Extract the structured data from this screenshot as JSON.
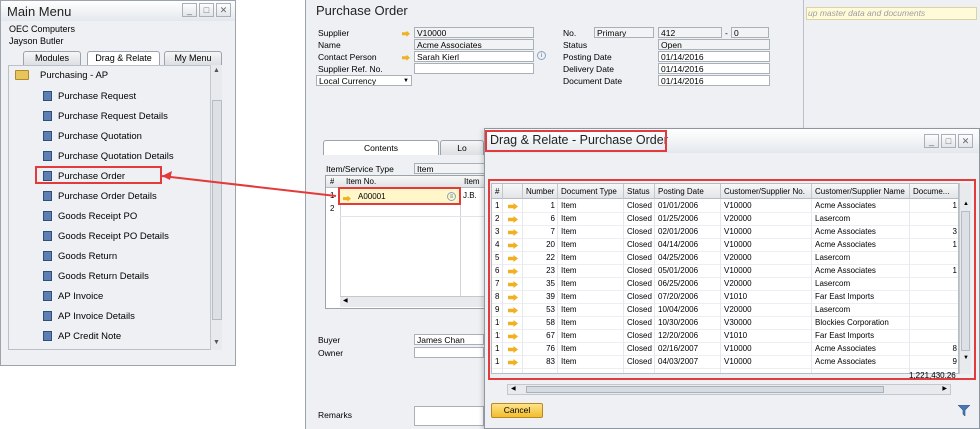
{
  "main_menu": {
    "title": "Main Menu",
    "company": "OEC Computers",
    "user": "Jayson Butler",
    "tabs": [
      "Modules",
      "Drag & Relate",
      "My Menu"
    ],
    "module": "Purchasing - AP",
    "items": [
      "Purchase Request",
      "Purchase Request Details",
      "Purchase Quotation",
      "Purchase Quotation Details",
      "Purchase Order",
      "Purchase Order Details",
      "Goods Receipt PO",
      "Goods Receipt PO Details",
      "Goods Return",
      "Goods Return Details",
      "AP Invoice",
      "AP Invoice Details",
      "AP Credit Note"
    ]
  },
  "purchase_order": {
    "title": "Purchase Order",
    "supplier_label": "Supplier",
    "supplier": "V10000",
    "name_label": "Name",
    "name": "Acme Associates",
    "contact_label": "Contact Person",
    "contact": "Sarah Kierl",
    "ref_label": "Supplier Ref. No.",
    "currency": "Local Currency",
    "no_label": "No.",
    "series": "Primary",
    "doc_no": "412",
    "doc_sub": "0",
    "status_label": "Status",
    "status": "Open",
    "posting_label": "Posting Date",
    "posting_date": "01/14/2016",
    "delivery_label": "Delivery Date",
    "delivery_date": "01/14/2016",
    "document_label": "Document Date",
    "document_date": "01/14/2016",
    "tabs": [
      "Contents",
      "Lo"
    ],
    "item_type_label": "Item/Service Type",
    "item_type": "Item",
    "grid_header": [
      "#",
      "Item No.",
      "Item"
    ],
    "row1_item": "A00001",
    "row1_desc": "J.B.",
    "buyer_label": "Buyer",
    "buyer": "James Chan",
    "owner_label": "Owner",
    "remarks_label": "Remarks"
  },
  "right_panel": {
    "placeholder": "up master data and documents"
  },
  "drag_relate": {
    "title": "Drag & Relate - Purchase Order",
    "columns": [
      "#",
      "Number",
      "Document Type",
      "Status",
      "Posting Date",
      "Customer/Supplier No.",
      "Customer/Supplier Name",
      "Docume..."
    ],
    "rows": [
      [
        "1",
        "1",
        "Item",
        "Closed",
        "01/01/2006",
        "V10000",
        "Acme Associates",
        "1"
      ],
      [
        "2",
        "6",
        "Item",
        "Closed",
        "01/25/2006",
        "V20000",
        "Lasercom",
        ""
      ],
      [
        "3",
        "7",
        "Item",
        "Closed",
        "02/01/2006",
        "V10000",
        "Acme Associates",
        "3"
      ],
      [
        "4",
        "20",
        "Item",
        "Closed",
        "04/14/2006",
        "V10000",
        "Acme Associates",
        "1"
      ],
      [
        "5",
        "22",
        "Item",
        "Closed",
        "04/25/2006",
        "V20000",
        "Lasercom",
        ""
      ],
      [
        "6",
        "23",
        "Item",
        "Closed",
        "05/01/2006",
        "V10000",
        "Acme Associates",
        "1"
      ],
      [
        "7",
        "35",
        "Item",
        "Closed",
        "06/25/2006",
        "V20000",
        "Lasercom",
        ""
      ],
      [
        "8",
        "39",
        "Item",
        "Closed",
        "07/20/2006",
        "V1010",
        "Far East Imports",
        ""
      ],
      [
        "9",
        "53",
        "Item",
        "Closed",
        "10/04/2006",
        "V20000",
        "Lasercom",
        ""
      ],
      [
        "10",
        "58",
        "Item",
        "Closed",
        "10/30/2006",
        "V30000",
        "Blockies Corporation",
        ""
      ],
      [
        "11",
        "67",
        "Item",
        "Closed",
        "12/20/2006",
        "V1010",
        "Far East Imports",
        ""
      ],
      [
        "12",
        "76",
        "Item",
        "Closed",
        "02/16/2007",
        "V10000",
        "Acme Associates",
        "8"
      ],
      [
        "13",
        "83",
        "Item",
        "Closed",
        "04/03/2007",
        "V10000",
        "Acme Associates",
        "9"
      ]
    ],
    "total": "1,221,430.26",
    "cancel_label": "Cancel"
  },
  "colors": {
    "highlight": "#e33b3b",
    "link_arrow": "#f0b020",
    "button": "#f2bd2c"
  }
}
